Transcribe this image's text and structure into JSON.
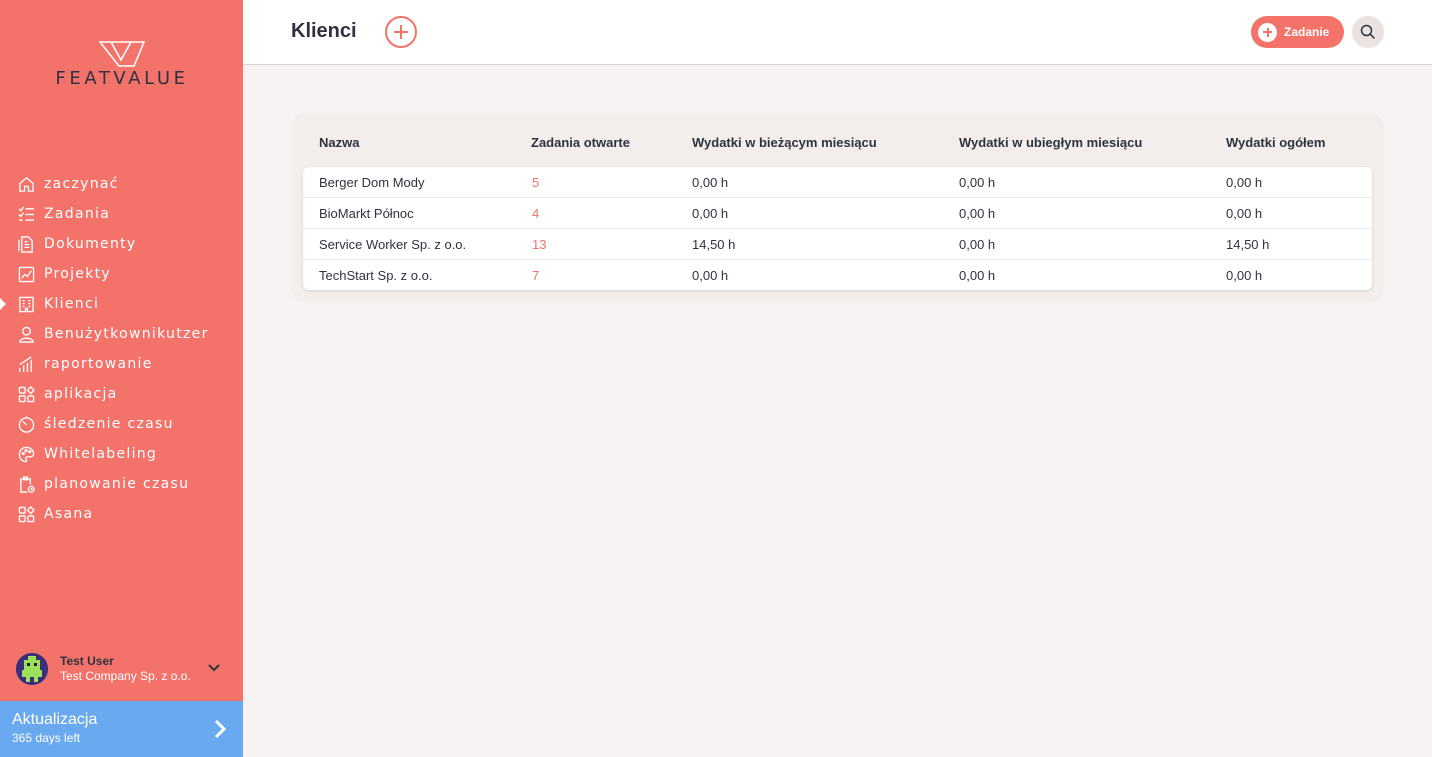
{
  "brand": {
    "logo_text": "FEATVALUE",
    "primary_color": "#f3736b",
    "upgrade_color": "#69a9ef"
  },
  "sidebar": {
    "items": [
      {
        "label": "zaczynać",
        "icon": "home-icon",
        "active": false
      },
      {
        "label": "Zadania",
        "icon": "checklist-icon",
        "active": false
      },
      {
        "label": "Dokumenty",
        "icon": "document-icon",
        "active": false
      },
      {
        "label": "Projekty",
        "icon": "chart-board-icon",
        "active": false
      },
      {
        "label": "Klienci",
        "icon": "building-icon",
        "active": true
      },
      {
        "label": "Benużytkownikutzer",
        "icon": "user-icon",
        "active": false
      },
      {
        "label": "raportowanie",
        "icon": "bar-chart-icon",
        "active": false
      },
      {
        "label": "aplikacja",
        "icon": "apps-icon",
        "active": false
      },
      {
        "label": "śledzenie czasu",
        "icon": "timer-icon",
        "active": false
      },
      {
        "label": "Whitelabeling",
        "icon": "palette-icon",
        "active": false
      },
      {
        "label": "planowanie czasu",
        "icon": "clipboard-clock-icon",
        "active": false
      },
      {
        "label": "Asana",
        "icon": "apps-icon",
        "active": false
      }
    ],
    "user": {
      "name": "Test User",
      "company": "Test Company Sp. z o.o."
    },
    "upgrade": {
      "title": "Aktualizacja",
      "subtitle": "365 days left"
    }
  },
  "header": {
    "title": "Klienci",
    "task_button": "Zadanie"
  },
  "table": {
    "columns": [
      "Nazwa",
      "Zadania otwarte",
      "Wydatki w bieżącym miesiącu",
      "Wydatki w ubiegłym miesiącu",
      "Wydatki ogółem"
    ],
    "rows": [
      [
        "Berger Dom Mody",
        "5",
        "0,00 h",
        "0,00 h",
        "0,00 h"
      ],
      [
        "BioMarkt Północ",
        "4",
        "0,00 h",
        "0,00 h",
        "0,00 h"
      ],
      [
        "Service Worker Sp. z o.o.",
        "13",
        "14,50 h",
        "0,00 h",
        "14,50 h"
      ],
      [
        "TechStart Sp. z o.o.",
        "7",
        "0,00 h",
        "0,00 h",
        "0,00 h"
      ]
    ]
  }
}
